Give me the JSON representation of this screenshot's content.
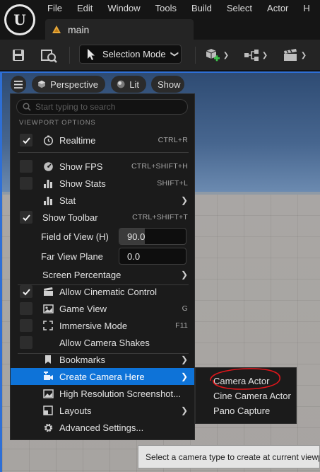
{
  "menubar": {
    "items": [
      "File",
      "Edit",
      "Window",
      "Tools",
      "Build",
      "Select",
      "Actor",
      "H"
    ],
    "logo_text": "U"
  },
  "document_tab": {
    "label": "main"
  },
  "toolbar": {
    "selection_mode_label": "Selection Mode",
    "icons": [
      "save-icon",
      "content-browser-icon",
      "add-actor-icon",
      "blueprint-icon",
      "cinematics-icon"
    ]
  },
  "viewport": {
    "perspective_label": "Perspective",
    "lit_label": "Lit",
    "show_label": "Show",
    "colors": {
      "selection_blue": "#0e73d8",
      "annotation_red": "#e0161b"
    }
  },
  "dropdown": {
    "search_placeholder": "Start typing to search",
    "section_header": "VIEWPORT OPTIONS",
    "items": [
      {
        "label": "Realtime",
        "shortcut": "CTRL+R",
        "checked": true,
        "icon": "clock-icon"
      },
      {
        "label": "Show FPS",
        "shortcut": "CTRL+SHIFT+H",
        "checked": false,
        "icon": "gauge-icon"
      },
      {
        "label": "Show Stats",
        "shortcut": "SHIFT+L",
        "checked": false,
        "icon": "bar-chart-icon"
      },
      {
        "label": "Stat",
        "submenu": true,
        "icon": "bar-chart-icon"
      },
      {
        "label": "Show Toolbar",
        "shortcut": "CTRL+SHIFT+T",
        "checked": true
      },
      {
        "label": "Field of View (H)",
        "value": "90.0"
      },
      {
        "label": "Far View Plane",
        "value": "0.0"
      },
      {
        "label": "Screen Percentage",
        "submenu": true
      },
      {
        "label": "Allow Cinematic Control",
        "checked": true,
        "icon": "clapperboard-icon"
      },
      {
        "label": "Game View",
        "shortcut": "G",
        "checked": false,
        "icon": "game-view-icon"
      },
      {
        "label": "Immersive Mode",
        "shortcut": "F11",
        "checked": false,
        "icon": "fullscreen-icon"
      },
      {
        "label": "Allow Camera Shakes",
        "checked": false
      },
      {
        "label": "Bookmarks",
        "submenu": true,
        "icon": "bookmark-icon"
      },
      {
        "label": "Create Camera Here",
        "submenu": true,
        "highlighted": true,
        "icon": "add-camera-icon"
      },
      {
        "label": "High Resolution Screenshot...",
        "icon": "screenshot-icon"
      },
      {
        "label": "Layouts",
        "submenu": true,
        "icon": "layout-icon"
      },
      {
        "label": "Advanced Settings...",
        "icon": "gear-icon"
      }
    ],
    "fov_fill_fraction": 0.38
  },
  "submenu": {
    "items": [
      "Camera Actor",
      "Cine Camera Actor",
      "Pano Capture"
    ]
  },
  "tooltip": {
    "text": "Select a camera type to create at current viewp"
  }
}
